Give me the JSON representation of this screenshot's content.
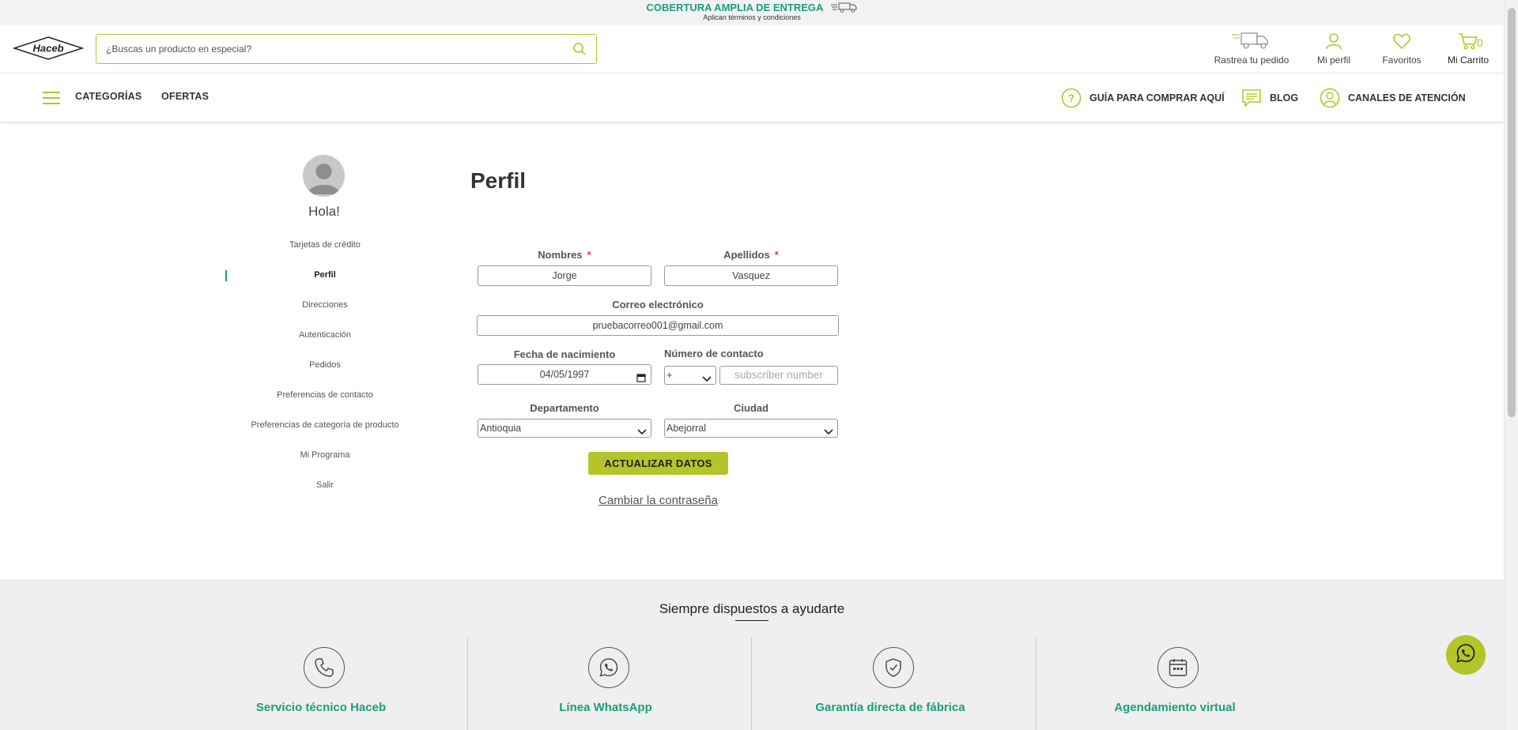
{
  "banner": {
    "title": "COBERTURA AMPLIA DE ENTREGA",
    "subtitle": "Aplican términos y condiciones",
    "icon": "delivery-truck-icon"
  },
  "header": {
    "logo_text": "Haceb",
    "search_placeholder": "¿Buscas un producto en especial?",
    "track_label": "Rastrea tu pedido",
    "profile_label": "Mi perfil",
    "favorites_label": "Favoritos",
    "cart_label": "Mi Carrito",
    "cart_count": "0"
  },
  "nav": {
    "categories": "CATEGORÍAS",
    "offers": "OFERTAS",
    "guide": "GUÍA PARA COMPRAR AQUÍ",
    "blog": "BLOG",
    "channels": "CANALES DE ATENCIÓN"
  },
  "sidebar": {
    "greeting": "Hola!",
    "items": [
      {
        "label": "Tarjetas de crédito",
        "active": false
      },
      {
        "label": "Perfil",
        "active": true
      },
      {
        "label": "Direcciones",
        "active": false
      },
      {
        "label": "Autenticación",
        "active": false
      },
      {
        "label": "Pedidos",
        "active": false
      },
      {
        "label": "Preferencias de contacto",
        "active": false
      },
      {
        "label": "Preferencias de categoría de producto",
        "active": false
      },
      {
        "label": "Mi Programa",
        "active": false
      },
      {
        "label": "Salir",
        "active": false
      }
    ]
  },
  "form": {
    "title": "Perfil",
    "first_name_label": "Nombres",
    "first_name_value": "Jorge",
    "last_name_label": "Apellidos",
    "last_name_value": "Vasquez",
    "required_mark": "*",
    "email_label": "Correo electrónico",
    "email_value": "pruebacorreo001@gmail.com",
    "birth_label": "Fecha de nacimiento",
    "birth_value": "04/05/1997",
    "phone_label": "Número de contacto",
    "phone_prefix": "+",
    "phone_placeholder": "subscriber number",
    "department_label": "Departamento",
    "department_value": "Antioquia",
    "city_label": "Ciudad",
    "city_value": "Abejorral",
    "submit_label": "ACTUALIZAR DATOS",
    "change_password": "Cambiar la contraseña"
  },
  "help": {
    "title": "Siempre dispuestos a ayudarte",
    "items": [
      {
        "label": "Servicio técnico Haceb",
        "icon": "phone-icon"
      },
      {
        "label": "Línea WhatsApp",
        "icon": "whatsapp-icon"
      },
      {
        "label": "Garantía directa de fábrica",
        "icon": "shield-check-icon"
      },
      {
        "label": "Agendamiento virtual",
        "icon": "calendar-icon"
      }
    ]
  },
  "colors": {
    "accent": "#b5c42a",
    "teal": "#1a9e7e"
  }
}
